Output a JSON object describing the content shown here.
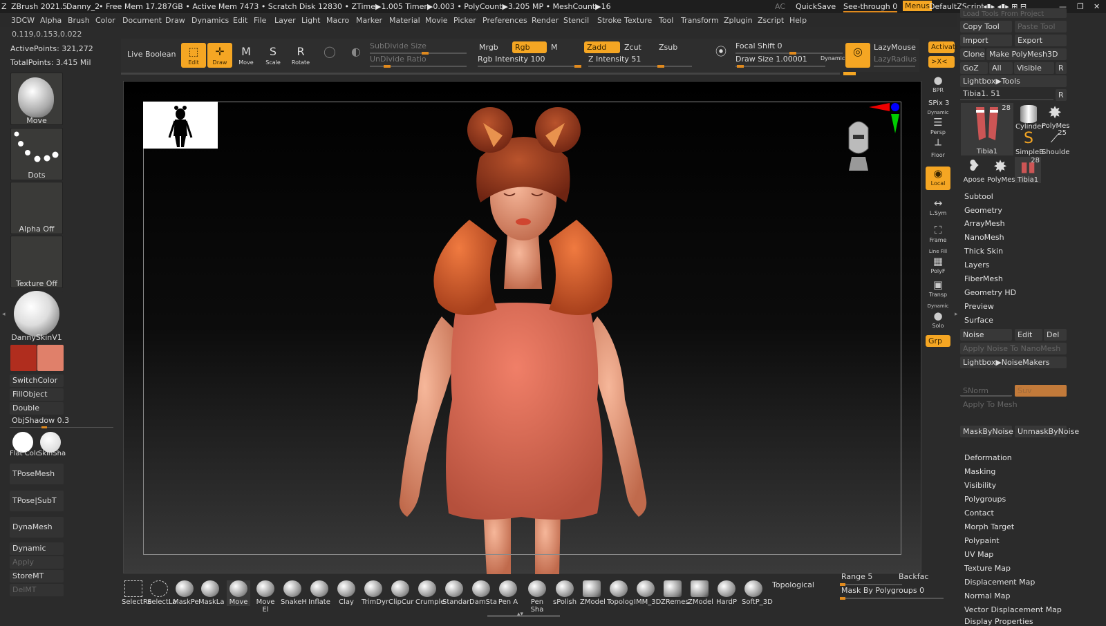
{
  "titlebar": {
    "app": "ZBrush 2021.5",
    "doc": "Danny_2",
    "stats": "• Free Mem 17.287GB • Active Mem 7473 • Scratch Disk 12830 • ZTime▶1.005 Timer▶0.003 • PolyCount▶3.205 MP • MeshCount▶16",
    "ac": "AC",
    "quicksave": "QuickSave",
    "see_through": "See-through",
    "see_through_val": "0",
    "menus": "Menus",
    "script": "DefaultZScript"
  },
  "menubar": [
    "3DCW",
    "Alpha",
    "Brush",
    "Color",
    "Document",
    "Draw",
    "Dynamics",
    "Edit",
    "File",
    "Layer",
    "Light",
    "Macro",
    "Marker",
    "Material",
    "Movie",
    "Picker",
    "Preferences",
    "Render",
    "Stencil",
    "Stroke",
    "Texture",
    "Tool",
    "Transform",
    "Zplugin",
    "Zscript",
    "Help"
  ],
  "info": {
    "coords": "0.119,0.153,0.022",
    "active_points": "ActivePoints: 321,272",
    "total_points": "TotalPoints: 3.415 Mil"
  },
  "toolbar": {
    "live_boolean": "Live Boolean",
    "edit": "Edit",
    "draw": "Draw",
    "move": "Move",
    "scale": "Scale",
    "rotate": "Rotate",
    "subdivide": "SubDivide Size",
    "undivide": "UnDivide Ratio",
    "mrgb": "Mrgb",
    "rgb": "Rgb",
    "m": "M",
    "rgb_intensity": "Rgb Intensity 100",
    "zadd": "Zadd",
    "zcut": "Zcut",
    "zsub": "Zsub",
    "z_intensity": "Z Intensity 51",
    "focal_shift": "Focal Shift 0",
    "draw_size": "Draw Size 1.00001",
    "dynamic": "Dynamic",
    "lazymouse": "LazyMouse",
    "lazyradius": "LazyRadius",
    "activate": "Activate",
    "xc": ">X<"
  },
  "left": {
    "brush": "Move",
    "stroke": "Dots",
    "alpha": "Alpha Off",
    "texture": "Texture Off",
    "material": "DannySkinV1",
    "switch_color": "SwitchColor",
    "fill_object": "FillObject",
    "double": "Double",
    "obj_shadow": "ObjShadow 0.3",
    "flat_color": "Flat Colc",
    "skin_shade": "SkinSha",
    "tpose_mesh": "TPoseMesh",
    "tpose_subt": "TPose|SubT",
    "dynamesh": "DynaMesh",
    "dynamic": "Dynamic",
    "apply": "Apply",
    "store_mt": "StoreMT",
    "del_mt": "DelMT",
    "primary_color": "#b02d1e",
    "secondary_color": "#e0806a"
  },
  "rstrip": {
    "bpr": "BPR",
    "spix": "SPix 3",
    "persp": "Persp",
    "dynamic": "Dynamic",
    "floor": "Floor",
    "local": "Local",
    "lsym": "L.Sym",
    "frame": "Frame",
    "line_fill": "Line Fill",
    "polyf": "PolyF",
    "transp": "Transp",
    "dynamic2": "Dynamic",
    "solo": "Solo",
    "grp": "Grp"
  },
  "right": {
    "load_tools": "Load Tools From Project",
    "copy_tool": "Copy Tool",
    "paste_tool": "Paste Tool",
    "import": "Import",
    "export": "Export",
    "clone": "Clone",
    "make_polymesh": "Make PolyMesh3D",
    "goz": "GoZ",
    "all": "All",
    "visible": "Visible",
    "r": "R",
    "lightbox_tools": "Lightbox▶Tools",
    "tibia": "Tibia1. 51",
    "r2": "R",
    "tools": [
      {
        "label": "Tibia1",
        "count": "28"
      },
      {
        "label": "Cylinder",
        "count": ""
      },
      {
        "label": "PolyMes",
        "count": ""
      },
      {
        "label": "SimpleB",
        "count": ""
      },
      {
        "label": "Shoulde",
        "count": "25"
      },
      {
        "label": "Apose",
        "count": ""
      },
      {
        "label": "PolyMes",
        "count": ""
      },
      {
        "label": "Tibia1",
        "count": "28"
      }
    ],
    "sections_top": [
      "Subtool",
      "Geometry",
      "ArrayMesh",
      "NanoMesh",
      "Thick Skin",
      "Layers",
      "FiberMesh",
      "Geometry HD",
      "Preview",
      "Surface"
    ],
    "noise": "Noise",
    "edit": "Edit",
    "del": "Del",
    "apply_noise": "Apply Noise To NanoMesh",
    "lightbox_noise": "Lightbox▶NoiseMakers",
    "snorm": "SNorm",
    "suv": "Suv",
    "apply_to_mesh": "Apply To Mesh",
    "mask_by_noise": "MaskByNoise",
    "unmask_by_noise": "UnmaskByNoise",
    "sections_bottom": [
      "Deformation",
      "Masking",
      "Visibility",
      "Polygroups",
      "Contact",
      "Morph Target",
      "Polypaint",
      "UV Map",
      "Texture Map",
      "Displacement Map",
      "Normal Map",
      "Vector Displacement Map",
      "Display Properties"
    ]
  },
  "bottom": {
    "brushes": [
      "SelectRe",
      "SelectLa",
      "MaskPe",
      "MaskLa",
      "Move",
      "Move El",
      "SnakeH",
      "Inflate",
      "Clay",
      "TrimDyr",
      "ClipCur",
      "Crumple",
      "Standar",
      "DamSta",
      "Pen A",
      "Pen Sha",
      "sPolish",
      "ZModel",
      "Topolog",
      "IMM_3D",
      "ZRemes",
      "ZModel",
      "HardP",
      "SoftP_3D"
    ],
    "topological": "Topological",
    "range": "Range 5",
    "backface": "Backfac",
    "mask_polygroups": "Mask By Polygroups 0"
  }
}
